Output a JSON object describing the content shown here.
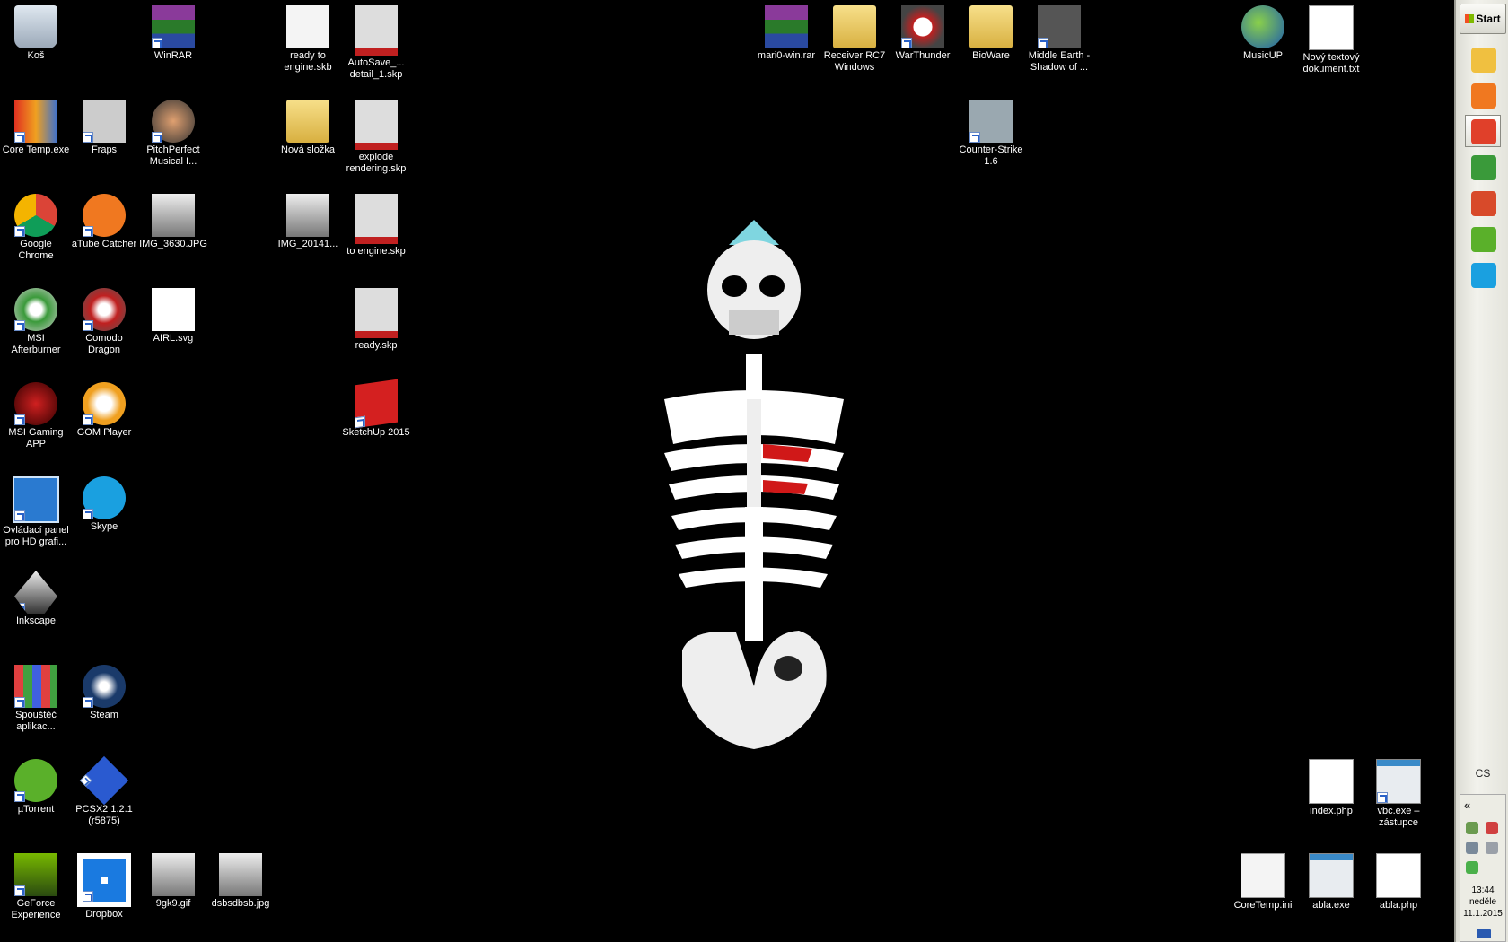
{
  "desktop": {
    "icons": [
      {
        "label": "Koš",
        "icon": "recycle-bin-icon"
      },
      {
        "label": "WinRAR",
        "icon": "winrar-icon"
      },
      {
        "label": "ready to engine.skb",
        "icon": "sketchup-backup-icon"
      },
      {
        "label": "AutoSave_... detail_1.skp",
        "icon": "sketchup-file-icon"
      },
      {
        "label": "mari0-win.rar",
        "icon": "rar-archive-icon"
      },
      {
        "label": "Receiver RC7 Windows",
        "icon": "folder-icon"
      },
      {
        "label": "WarThunder",
        "icon": "warthunder-icon"
      },
      {
        "label": "BioWare",
        "icon": "folder-icon"
      },
      {
        "label": "Middle Earth - Shadow of ...",
        "icon": "game-icon"
      },
      {
        "label": "MusicUP",
        "icon": "globe-music-icon"
      },
      {
        "label": "Nový textový dokument.txt",
        "icon": "text-file-icon"
      },
      {
        "label": "Core Temp.exe",
        "icon": "thermometer-icon"
      },
      {
        "label": "Fraps",
        "icon": "fraps-icon"
      },
      {
        "label": "PitchPerfect Musical I...",
        "icon": "tuner-icon"
      },
      {
        "label": "Nová složka",
        "icon": "folder-icon"
      },
      {
        "label": "explode rendering.skp",
        "icon": "sketchup-file-icon"
      },
      {
        "label": "Counter-Strike 1.6",
        "icon": "counter-strike-icon"
      },
      {
        "label": "Google Chrome",
        "icon": "chrome-icon"
      },
      {
        "label": "aTube Catcher",
        "icon": "atube-icon"
      },
      {
        "label": "IMG_3630.JPG",
        "icon": "image-file-icon"
      },
      {
        "label": "IMG_20141...",
        "icon": "image-file-icon"
      },
      {
        "label": "to engine.skp",
        "icon": "sketchup-file-icon"
      },
      {
        "label": "MSI Afterburner",
        "icon": "afterburner-icon"
      },
      {
        "label": "Comodo Dragon",
        "icon": "comodo-dragon-icon"
      },
      {
        "label": "AIRL.svg",
        "icon": "svg-file-icon"
      },
      {
        "label": "ready.skp",
        "icon": "sketchup-file-icon"
      },
      {
        "label": "MSI Gaming APP",
        "icon": "msi-gaming-icon"
      },
      {
        "label": "GOM Player",
        "icon": "gom-player-icon"
      },
      {
        "label": "SketchUp 2015",
        "icon": "sketchup-icon"
      },
      {
        "label": "Ovládací panel pro HD grafi...",
        "icon": "intel-hd-icon"
      },
      {
        "label": "Skype",
        "icon": "skype-icon"
      },
      {
        "label": "Inkscape",
        "icon": "inkscape-icon"
      },
      {
        "label": "Spouštěč aplikac...",
        "icon": "app-launcher-icon"
      },
      {
        "label": "Steam",
        "icon": "steam-icon"
      },
      {
        "label": "µTorrent",
        "icon": "utorrent-icon"
      },
      {
        "label": "PCSX2 1.2.1 (r5875)",
        "icon": "pcsx2-icon"
      },
      {
        "label": "index.php",
        "icon": "php-file-icon"
      },
      {
        "label": "vbc.exe – zástupce",
        "icon": "exe-window-icon"
      },
      {
        "label": "GeForce Experience",
        "icon": "geforce-icon"
      },
      {
        "label": "Dropbox",
        "icon": "dropbox-icon"
      },
      {
        "label": "9gk9.gif",
        "icon": "image-file-icon"
      },
      {
        "label": "dsbsdbsb.jpg",
        "icon": "image-file-icon"
      },
      {
        "label": "CoreTemp.ini",
        "icon": "settings-file-icon"
      },
      {
        "label": "abla.exe",
        "icon": "exe-window-icon"
      },
      {
        "label": "abla.php",
        "icon": "php-file-icon"
      }
    ]
  },
  "taskbar": {
    "start_label": "Start",
    "quicklaunch": [
      {
        "icon": "explorer-folder-icon",
        "color": "#f0c040"
      },
      {
        "icon": "media-player-icon",
        "color": "#f07820"
      },
      {
        "icon": "chrome-icon",
        "color": "#e0402a"
      },
      {
        "icon": "afterburner-icon",
        "color": "#3a9a3a"
      },
      {
        "icon": "core-temp-icon",
        "color": "#d84a2a"
      },
      {
        "icon": "utorrent-icon",
        "color": "#5ab02a"
      },
      {
        "icon": "skype-icon",
        "color": "#1aa0e0"
      }
    ],
    "language": "CS",
    "tray_chevron": "«",
    "clock_time": "13:44",
    "clock_day": "neděle",
    "clock_date": "11.1.2015"
  }
}
